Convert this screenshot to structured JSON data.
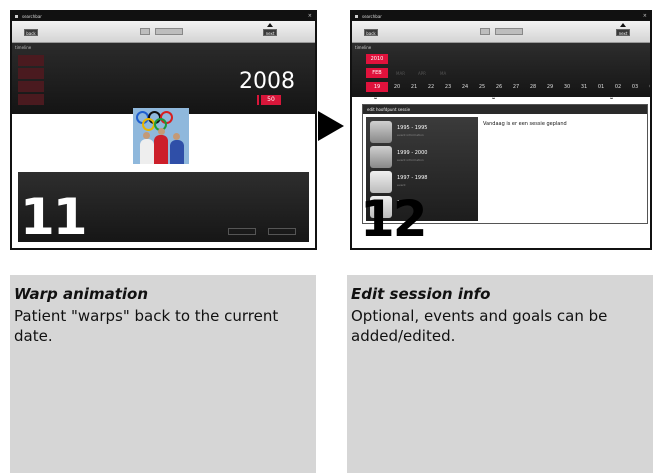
{
  "left_screen": {
    "window_title": "searchbar",
    "toolbar_left": "back",
    "toolbar_right": "next",
    "timeline_label": "timeline",
    "year": "2008",
    "year_tag": "50",
    "step_number": "11",
    "bottom_buttons": [
      "cancel",
      "ok"
    ]
  },
  "right_screen": {
    "window_title": "searchbar",
    "toolbar_left": "back",
    "toolbar_right": "next",
    "timeline_label": "timeline",
    "year_chip": "2010",
    "month_chip": "FEB",
    "months": [
      "MAR",
      "APR",
      "MA"
    ],
    "day_chip": "19",
    "days": [
      "20",
      "21",
      "22",
      "23",
      "24",
      "25",
      "26",
      "27",
      "28",
      "29",
      "30",
      "31",
      "01",
      "02",
      "03",
      "0"
    ],
    "panel_title": "edit hoofdpunt sessie",
    "list_items": [
      {
        "title": "1995 - 1995",
        "sub": "event information"
      },
      {
        "title": "1999 - 2000",
        "sub": "event information"
      },
      {
        "title": "1997 - 1998",
        "sub": "event"
      },
      {
        "title": "1996",
        "sub": ""
      }
    ],
    "message": "Vandaag is er een sessie gepland",
    "step_number": "12"
  },
  "captions": {
    "left": {
      "title": "Warp animation",
      "body": "Patient \"warps\" back to the current date."
    },
    "right": {
      "title": "Edit session info",
      "body": "Optional, events and goals can be added/edited."
    }
  },
  "colors": {
    "accent_red": "#d8163a",
    "panel_dark": "#1a1a1a",
    "caption_bg": "#d6d6d6"
  }
}
